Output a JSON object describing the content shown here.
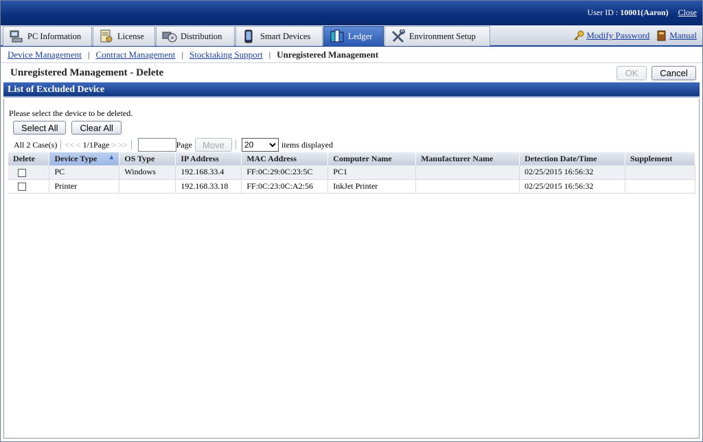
{
  "header": {
    "user_label": "User ID : ",
    "user_id": "10001(Aaron)",
    "close_label": "Close"
  },
  "tabs": [
    {
      "label": "PC Information",
      "icon": "pc-icon",
      "active": false
    },
    {
      "label": "License",
      "icon": "license-icon",
      "active": false
    },
    {
      "label": "Distribution",
      "icon": "distribution-icon",
      "active": false
    },
    {
      "label": "Smart Devices",
      "icon": "phone-icon",
      "active": false
    },
    {
      "label": "Ledger",
      "icon": "ledger-icon",
      "active": true
    },
    {
      "label": "Environment Setup",
      "icon": "tools-icon",
      "active": false
    }
  ],
  "top_links": {
    "modify_password": "Modify Password",
    "manual": "Manual"
  },
  "subnav": {
    "items": [
      "Device Management",
      "Contract Management",
      "Stocktaking Support"
    ],
    "current": "Unregistered Management"
  },
  "page": {
    "title": "Unregistered Management - Delete",
    "ok_label": "OK",
    "cancel_label": "Cancel"
  },
  "section": {
    "title": "List of Excluded Device",
    "instruction": "Please select the device to be deleted.",
    "select_all": "Select All",
    "clear_all": "Clear All"
  },
  "pager": {
    "total": "All 2 Case(s)",
    "first": "<<",
    "prev": "<",
    "page_info": "1/1Page",
    "next": ">",
    "last": ">>",
    "page_label": "Page",
    "move_label": "Move",
    "items_value": "20",
    "items_label": "items displayed"
  },
  "table": {
    "columns": [
      "Delete",
      "Device Type",
      "OS Type",
      "IP Address",
      "MAC Address",
      "Computer Name",
      "Manufacturer Name",
      "Detection Date/Time",
      "Supplement"
    ],
    "rows": [
      {
        "device_type": "PC",
        "os_type": "Windows",
        "ip": "192.168.33.4",
        "mac": "FF:0C:29:0C:23:5C",
        "computer_name": "PC1",
        "manufacturer": "",
        "detected": "02/25/2015 16:56:32",
        "supplement": ""
      },
      {
        "device_type": "Printer",
        "os_type": "",
        "ip": "192.168.33.18",
        "mac": "FF:0C:23:0C:A2:56",
        "computer_name": "InkJet Printer",
        "manufacturer": "",
        "detected": "02/25/2015 16:56:32",
        "supplement": ""
      }
    ]
  },
  "colors": {
    "header_blue": "#0b2f7c",
    "link_blue": "#1a3ea0",
    "active_tab": "#2a58b0"
  }
}
